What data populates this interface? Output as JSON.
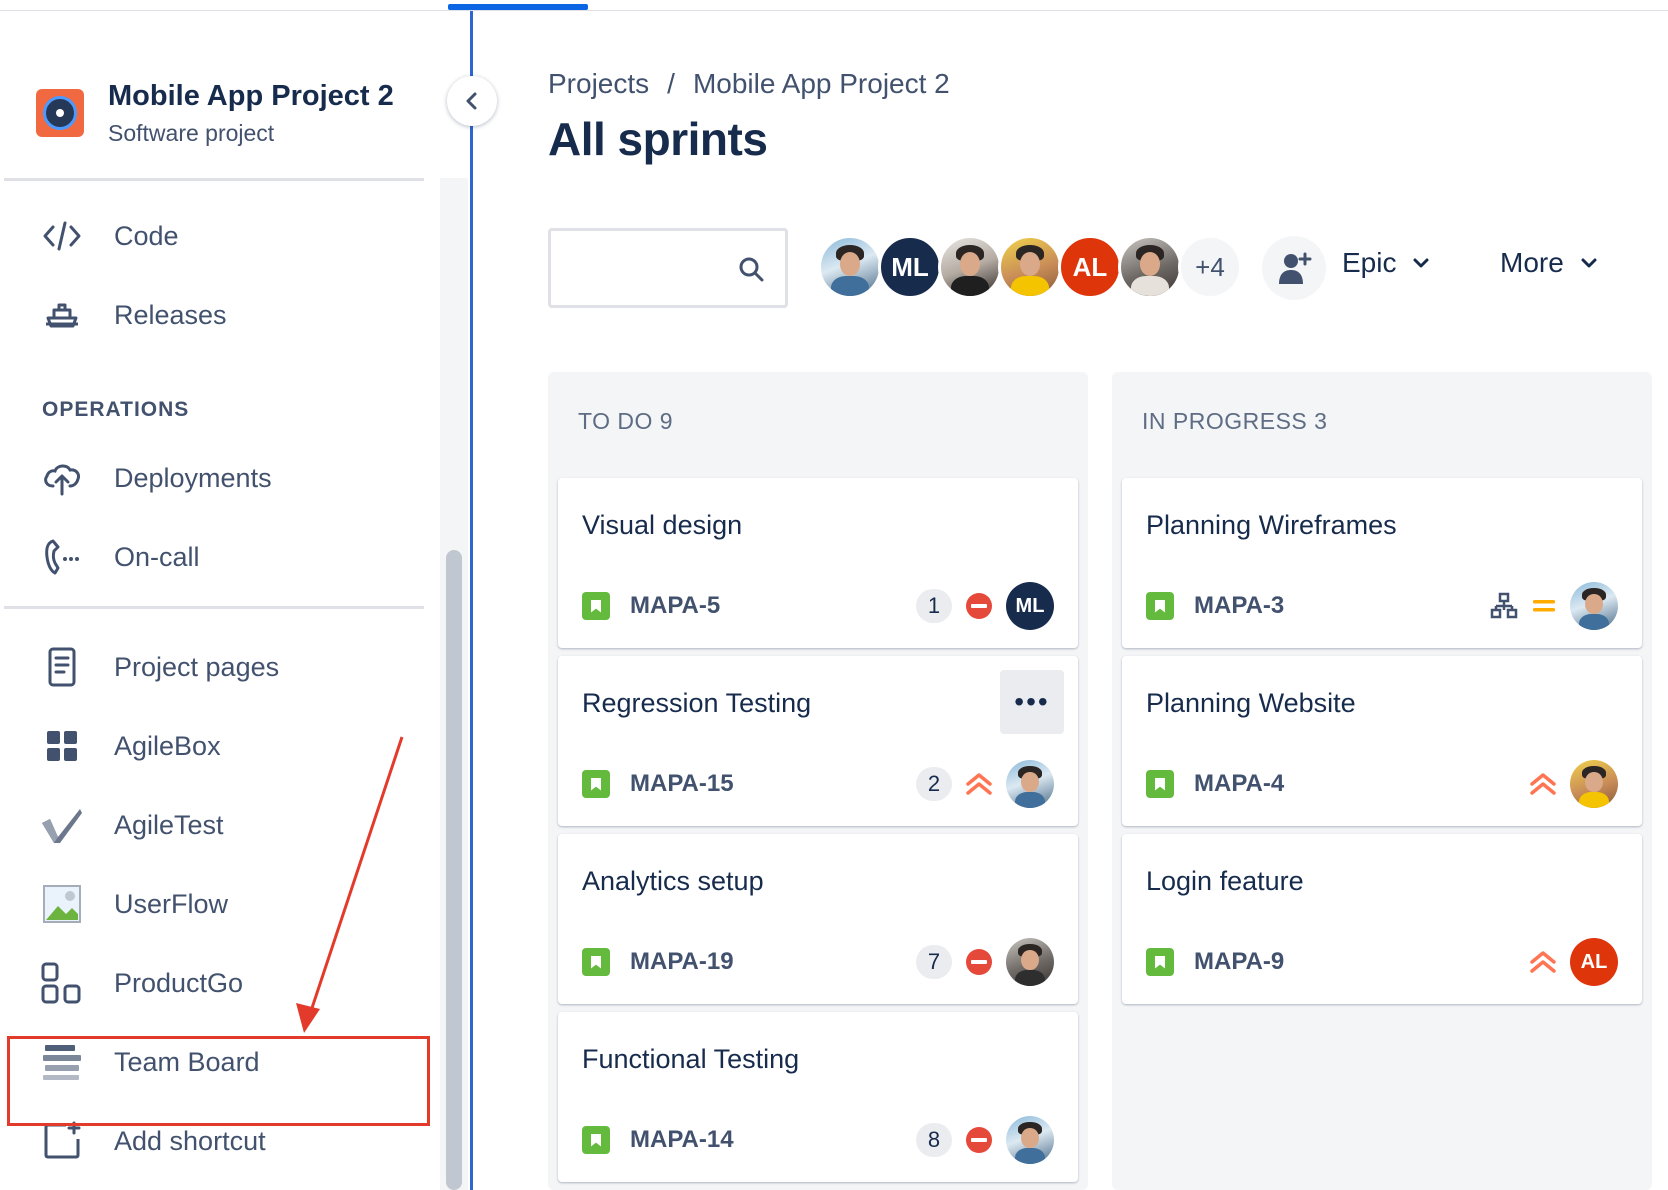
{
  "project": {
    "name": "Mobile App Project 2",
    "type": "Software project"
  },
  "sidebar": {
    "items_top": [
      {
        "label": "Code",
        "icon": "code-icon"
      },
      {
        "label": "Releases",
        "icon": "ship-icon"
      }
    ],
    "section_operations": "OPERATIONS",
    "items_ops": [
      {
        "label": "Deployments",
        "icon": "cloud-upload-icon"
      },
      {
        "label": "On-call",
        "icon": "phone-icon"
      }
    ],
    "items_apps": [
      {
        "label": "Project pages",
        "icon": "page-icon"
      },
      {
        "label": "AgileBox",
        "icon": "grid-icon"
      },
      {
        "label": "AgileTest",
        "icon": "checkmark-icon"
      },
      {
        "label": "UserFlow",
        "icon": "image-icon"
      },
      {
        "label": "ProductGo",
        "icon": "blocks-icon"
      },
      {
        "label": "Team Board",
        "icon": "board-icon"
      },
      {
        "label": "Add shortcut",
        "icon": "add-shortcut-icon"
      }
    ]
  },
  "breadcrumb": {
    "root": "Projects",
    "separator": "/",
    "project": "Mobile App Project 2"
  },
  "page": {
    "title": "All sprints"
  },
  "toolbar": {
    "search_placeholder": "",
    "avatars": [
      {
        "initials": "",
        "style": "photo",
        "color": "#8ab9d9"
      },
      {
        "initials": "ML",
        "style": "initials",
        "color": "#172b4d"
      },
      {
        "initials": "",
        "style": "photo",
        "color": "#b5aca3"
      },
      {
        "initials": "",
        "style": "photo",
        "color": "#f0d24a"
      },
      {
        "initials": "AL",
        "style": "initials",
        "color": "#de350b"
      },
      {
        "initials": "",
        "style": "photo",
        "color": "#6f6a66"
      }
    ],
    "more_avatars": "+4",
    "epic_label": "Epic",
    "more_label": "More"
  },
  "board": {
    "columns": [
      {
        "title": "TO DO 9",
        "cards": [
          {
            "title": "Visual design",
            "key": "MAPA-5",
            "estimate": "1",
            "priority": "blocker",
            "assignee": "ML"
          },
          {
            "title": "Regression Testing",
            "key": "MAPA-15",
            "estimate": "2",
            "priority": "high",
            "assignee": "",
            "menu": "•••"
          },
          {
            "title": "Analytics setup",
            "key": "MAPA-19",
            "estimate": "7",
            "priority": "blocker",
            "assignee": ""
          },
          {
            "title": "Functional Testing",
            "key": "MAPA-14",
            "estimate": "8",
            "priority": "blocker",
            "assignee": ""
          }
        ]
      },
      {
        "title": "IN PROGRESS 3",
        "cards": [
          {
            "title": "Planning Wireframes",
            "key": "MAPA-3",
            "estimate": "",
            "priority": "medium",
            "assignee": ""
          },
          {
            "title": "Planning Website",
            "key": "MAPA-4",
            "estimate": "",
            "priority": "high",
            "assignee": ""
          },
          {
            "title": "Login feature",
            "key": "MAPA-9",
            "estimate": "",
            "priority": "high",
            "assignee": "AL"
          }
        ]
      }
    ]
  },
  "colors": {
    "accent": "#0c66e4",
    "annotation": "#e33b2b",
    "story": "#63ba3c",
    "blocker": "#e5493a",
    "high": "#ff7452",
    "medium": "#ffab00"
  }
}
